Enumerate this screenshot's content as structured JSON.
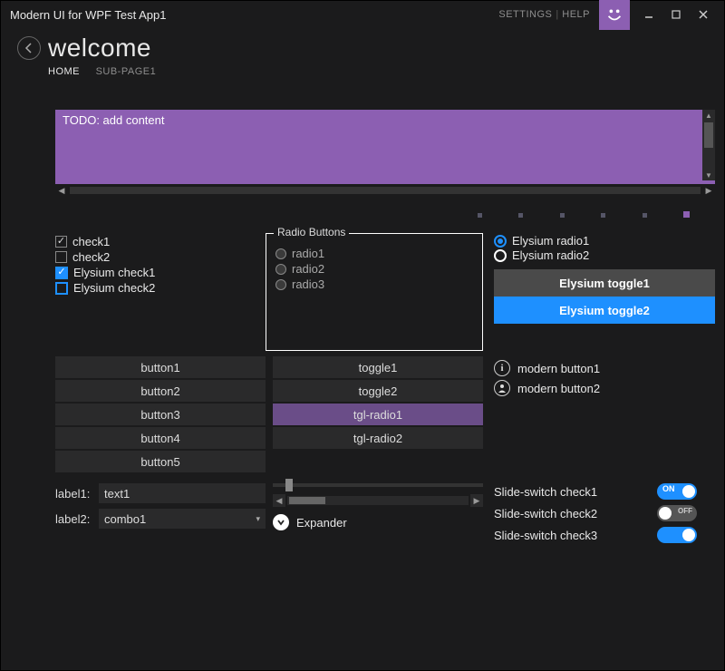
{
  "window": {
    "title": "Modern UI for WPF Test App1",
    "settings": "SETTINGS",
    "help": "HELP"
  },
  "header": {
    "title": "welcome",
    "tabs": [
      "HOME",
      "SUB-PAGE1"
    ],
    "active_tab": 0
  },
  "todo": {
    "text": "TODO: add content"
  },
  "checkboxes": {
    "check1": "check1",
    "check2": "check2",
    "echeck1": "Elysium check1",
    "echeck2": "Elysium check2"
  },
  "radio_group": {
    "legend": "Radio Buttons",
    "items": [
      "radio1",
      "radio2",
      "radio3"
    ]
  },
  "eradios": {
    "r1": "Elysium radio1",
    "r2": "Elysium radio2"
  },
  "etoggles": {
    "t1": "Elysium toggle1",
    "t2": "Elysium toggle2"
  },
  "buttons": [
    "button1",
    "button2",
    "button3",
    "button4",
    "button5"
  ],
  "toggles": [
    "toggle1",
    "toggle2",
    "tgl-radio1",
    "tgl-radio2"
  ],
  "mbuttons": {
    "b1": "modern button1",
    "b2": "modern button2"
  },
  "form": {
    "label1": "label1:",
    "text1": "text1",
    "label2": "label2:",
    "combo1": "combo1"
  },
  "expander": "Expander",
  "switches": {
    "s1": "Slide-switch check1",
    "s2": "Slide-switch check2",
    "s3": "Slide-switch check3",
    "on": "ON",
    "off": "OFF"
  }
}
